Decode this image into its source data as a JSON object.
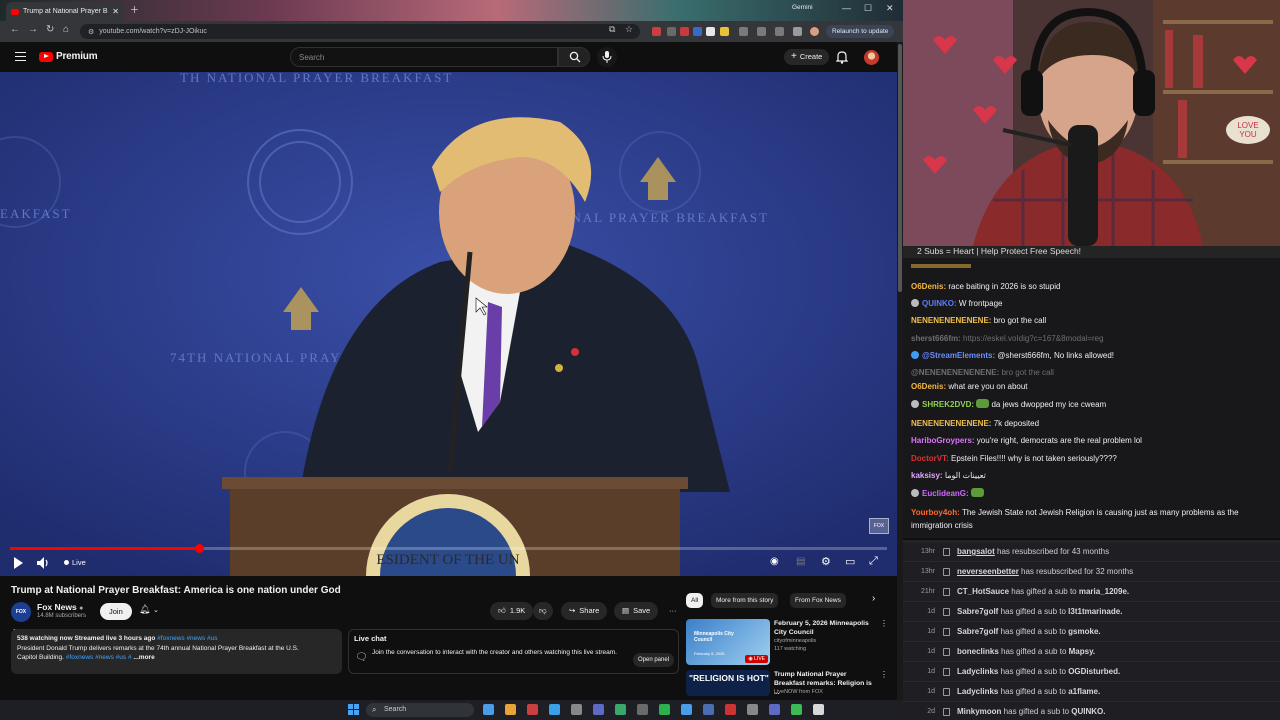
{
  "browser": {
    "tab_title": "Trump at National Prayer B",
    "gemini_label": "Gemini",
    "url": "youtube.com/watch?v=zDJ-JOikuc",
    "relaunch_label": "Relaunch to update"
  },
  "youtube": {
    "logo_text": "Premium",
    "search_placeholder": "Search",
    "create_label": "Create",
    "player": {
      "live_label": "Live",
      "progress_fraction": 0.215
    },
    "video": {
      "title": "Trump at National Prayer Breakfast: America is one nation under God",
      "channel": {
        "name": "Fox News",
        "subscribers": "14.8M subscribers",
        "avatar_text": "FOX NEWS"
      },
      "join_label": "Join",
      "likes": "1.9K",
      "share_label": "Share",
      "save_label": "Save"
    },
    "description": {
      "stats": "538 watching now  Streamed live 3 hours ago",
      "stats_tags": "#foxnews #news #us",
      "line2": "President Donald Trump delivers remarks at the 74th annual National Prayer Breakfast at the U.S.",
      "line3_text": "Capitol Building.",
      "line3_tags": "#foxnews #news #us #",
      "more": "...more"
    },
    "live_chat": {
      "title": "Live chat",
      "text": "Join the conversation to interact with the creator and others watching this live stream.",
      "open_panel_label": "Open panel"
    },
    "rec_chips": [
      "All",
      "More from this story",
      "From Fox News"
    ],
    "recommendations": [
      {
        "title": "February 5, 2026 Minneapolis City Council",
        "channel": "cityofminneapolis",
        "meta": "117 watching",
        "thumb_text": "Minneapolis City Council",
        "thumb_subtext": "February 5, 2026",
        "badge": "LIVE"
      },
      {
        "title": "Trump National Prayer Breakfast remarks: Religion is ...",
        "channel": "LiveNOW from FOX",
        "meta": "",
        "thumb_text": "\"RELIGION IS HOT\""
      }
    ]
  },
  "stream": {
    "caption": "2 Subs = Heart | Help Protect Free Speech!",
    "chat": [
      {
        "user": "O6Denis",
        "color": "#f5b83d",
        "text": "race baiting in 2026 is so stupid"
      },
      {
        "user": "QUINKO",
        "color": "#5b7cff",
        "text": "W frontpage",
        "badge": "#bbbbbb"
      },
      {
        "user": "NENENENENENENE",
        "color": "#f0c04a",
        "text": "bro got the call"
      },
      {
        "user": "sherst666fm",
        "color": "#5a5a5e",
        "text": "https://eskel.voIdig?c=167&8modal=reg",
        "dim": true
      },
      {
        "user": "@StreamElements",
        "color": "#6a8fff",
        "text": "@sherst666fm, No links allowed!",
        "badge": "#3f9cf3"
      },
      {
        "user": "@NENENENENENENE",
        "color": "#6e6e72",
        "text": "bro got the call",
        "dim": true
      },
      {
        "user": "O6Denis",
        "color": "#f5b83d",
        "text": "what are you on about"
      },
      {
        "user": "SHREK2DVD",
        "color": "#8fd14f",
        "text": "da jews dwopped my ice cweam",
        "badge": "#bbbbbb",
        "emote": true
      },
      {
        "user": "NENENENENENENE",
        "color": "#f0c04a",
        "text": "7k deposited"
      },
      {
        "user": "HariboGroypers",
        "color": "#e072ff",
        "text": "you're right, democrats are the real problem lol"
      },
      {
        "user": "DoctorVT",
        "color": "#e03030",
        "text": "Epstein Files!!!! why is not taken seriously????"
      },
      {
        "user": "kaksisy",
        "color": "#e0a8ff",
        "text": "تعيينات الوما"
      },
      {
        "user": "EuclideanG",
        "color": "#d06aff",
        "text": "",
        "badge": "#bbbbbb",
        "emote": true
      },
      {
        "user": "Yourboy4oh",
        "color": "#ff6a2a",
        "text": "The Jewish State not Jewish Religion is causing just as many problems as the"
      },
      {
        "user": "",
        "color": "#efeff1",
        "text": "immigration crisis"
      }
    ],
    "events": [
      {
        "time": "13hr",
        "name": "bangsalot",
        "underline": true,
        "text": "has resubscribed for 43 months"
      },
      {
        "time": "13hr",
        "name": "neverseenbetter",
        "underline": true,
        "text": "has resubscribed for 32 months"
      },
      {
        "time": "21hr",
        "name": "CT_HotSauce",
        "text": "has gifted a sub to",
        "target": "maria_1209e."
      },
      {
        "time": "1d",
        "name": "Sabre7golf",
        "text": "has gifted a sub to",
        "target": "l3t1tmarinade."
      },
      {
        "time": "1d",
        "name": "Sabre7golf",
        "text": "has gifted a sub to",
        "target": "gsmoke."
      },
      {
        "time": "1d",
        "name": "boneclinks",
        "text": "has gifted a sub to",
        "target": "Mapsy."
      },
      {
        "time": "1d",
        "name": "Ladyclinks",
        "text": "has gifted a sub to",
        "target": "OGDisturbed."
      },
      {
        "time": "1d",
        "name": "Ladyclinks",
        "text": "has gifted a sub to",
        "target": "a1flame."
      },
      {
        "time": "2d",
        "name": "Minkymoon",
        "text": "has gifted a sub to",
        "target": "QUINKO."
      }
    ]
  },
  "taskbar": {
    "search_label": "Search",
    "apps": [
      "#4a9ee8",
      "#e8a23a",
      "#c94040",
      "#3aa0e8",
      "#888888",
      "#5c6ac4",
      "#3aa86a",
      "#6a6a6a",
      "#2bb24c",
      "#4a9ee8",
      "#4a6fb0",
      "#cc3333",
      "#888888",
      "#5c6ac4",
      "#3cba54",
      "#d8d8d8"
    ]
  }
}
